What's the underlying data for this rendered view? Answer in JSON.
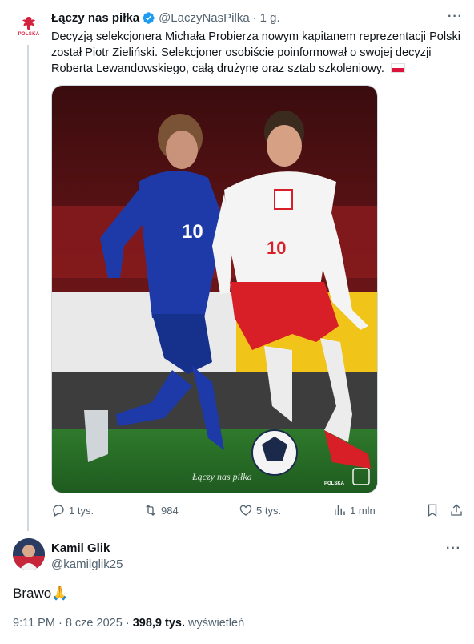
{
  "tweet": {
    "author_name": "Łączy nas piłka",
    "author_handle": "@LaczyNasPilka",
    "separator": "·",
    "time_ago": "1 g.",
    "avatar_label": "POLSKA",
    "text": "Decyzją selekcjonera Michała Probierza nowym kapitanem reprezentacji Polski został Piotr Zieliński. Selekcjoner osobiście poinformował o swojej decyzji Roberta Lewandowskiego, całą drużynę oraz sztab szkoleniowy.",
    "media": {
      "watermark": "Łączy nas piłka",
      "badge_label": "POLSKA",
      "player_left_number": "10",
      "player_right_number": "10"
    },
    "actions": {
      "replies": "1 tys.",
      "retweets": "984",
      "likes": "5 tys.",
      "views": "1 mln"
    },
    "icons": [
      "more-icon",
      "verified-icon",
      "reply-icon",
      "retweet-icon",
      "like-icon",
      "views-icon",
      "bookmark-icon",
      "share-icon",
      "flag-poland-icon"
    ]
  },
  "reply": {
    "author_name": "Kamil Glik",
    "author_handle": "@kamilglik25",
    "text": "Brawo🙏",
    "time": "9:11 PM",
    "separator": "·",
    "date": "8 cze 2025",
    "separator2": "·",
    "views_count": "398,9 tys.",
    "views_label": "wyświetleń"
  },
  "colors": {
    "text": "#0f1419",
    "muted": "#536471",
    "verified": "#1d9bf0",
    "border": "#cfd9de",
    "polska_red": "#d4213d"
  }
}
